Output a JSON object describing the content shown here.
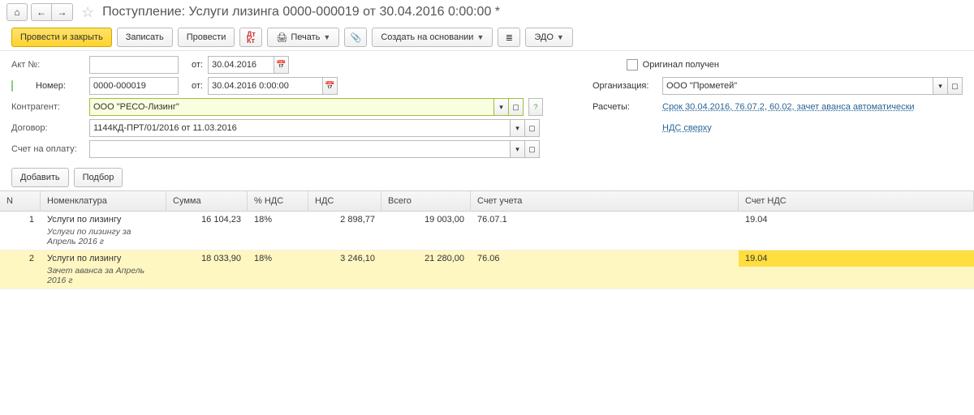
{
  "title": "Поступление: Услуги лизинга 0000-000019 от 30.04.2016 0:00:00 *",
  "toolbar": {
    "post_close": "Провести и закрыть",
    "write": "Записать",
    "post": "Провести",
    "print": "Печать",
    "create_based": "Создать на основании",
    "edo": "ЭДО"
  },
  "form": {
    "act_label": "Акт №:",
    "act_from_label": "от:",
    "act_date": "30.04.2016",
    "original_label": "Оригинал получен",
    "num_label": "Номер:",
    "num_value": "0000-000019",
    "num_from_label": "от:",
    "num_datetime": "30.04.2016  0:00:00",
    "org_label": "Организация:",
    "org_value": "ООО \"Прометей\"",
    "counterparty_label": "Контрагент:",
    "counterparty_value": "ООО \"РЕСО-Лизинг\"",
    "settlements_label": "Расчеты:",
    "settlements_link": "Срок 30.04.2016, 76.07.2, 60.02, зачет аванса автоматически",
    "contract_label": "Договор:",
    "contract_value": "1144КД-ПРТ/01/2016 от 11.03.2016",
    "vat_link": "НДС сверху",
    "invoice_label": "Счет на оплату:"
  },
  "sub_toolbar": {
    "add": "Добавить",
    "pick": "Подбор"
  },
  "grid": {
    "headers": {
      "n": "N",
      "nom": "Номенклатура",
      "sum": "Сумма",
      "vat_pct": "% НДС",
      "vat": "НДС",
      "total": "Всего",
      "acc": "Счет учета",
      "vatacc": "Счет НДС"
    },
    "rows": [
      {
        "n": "1",
        "nom": "Услуги по лизингу",
        "sub": "Услуги по лизингу  за Апрель 2016 г",
        "sum": "16 104,23",
        "vat_pct": "18%",
        "vat": "2 898,77",
        "total": "19 003,00",
        "acc": "76.07.1",
        "vatacc": "19.04"
      },
      {
        "n": "2",
        "nom": "Услуги по лизингу",
        "sub": "Зачет аванса за Апрель 2016 г",
        "sum": "18 033,90",
        "vat_pct": "18%",
        "vat": "3 246,10",
        "total": "21 280,00",
        "acc": "76.06",
        "vatacc": "19.04"
      }
    ]
  }
}
